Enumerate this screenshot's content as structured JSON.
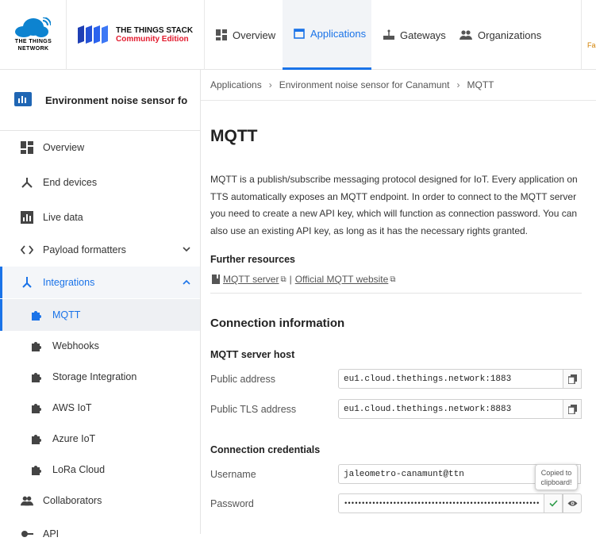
{
  "header": {
    "ttn_logo_text": "THE THINGS NETWORK",
    "tts_title": "THE THINGS STACK",
    "tts_subtitle": "Community Edition",
    "nav": [
      {
        "label": "Overview",
        "icon": "grid-icon"
      },
      {
        "label": "Applications",
        "icon": "application-icon",
        "active": true
      },
      {
        "label": "Gateways",
        "icon": "gateway-icon"
      },
      {
        "label": "Organizations",
        "icon": "people-icon"
      }
    ],
    "truncated_right": "Fa"
  },
  "sidebar": {
    "app_name": "Environment noise sensor for ...",
    "items": [
      {
        "label": "Overview",
        "icon": "dashboard-icon"
      },
      {
        "label": "End devices",
        "icon": "devices-icon"
      },
      {
        "label": "Live data",
        "icon": "chart-icon"
      },
      {
        "label": "Payload formatters",
        "icon": "code-icon",
        "expandable": true
      },
      {
        "label": "Integrations",
        "icon": "integrations-icon",
        "expanded": true
      },
      {
        "label": "MQTT",
        "icon": "puzzle-icon",
        "active": true
      },
      {
        "label": "Webhooks",
        "icon": "puzzle-icon"
      },
      {
        "label": "Storage Integration",
        "icon": "puzzle-icon"
      },
      {
        "label": "AWS IoT",
        "icon": "puzzle-icon"
      },
      {
        "label": "Azure IoT",
        "icon": "puzzle-icon"
      },
      {
        "label": "LoRa Cloud",
        "icon": "puzzle-icon"
      },
      {
        "label": "Collaborators",
        "icon": "people-icon"
      },
      {
        "label": "API",
        "icon": "key-icon"
      }
    ]
  },
  "breadcrumb": [
    "Applications",
    "Environment noise sensor for Canamunt",
    "MQTT"
  ],
  "main": {
    "title": "MQTT",
    "intro": "MQTT is a publish/subscribe messaging protocol designed for IoT. Every application on TTS automatically exposes an MQTT endpoint. In order to connect to the MQTT server you need to create a new API key, which will function as connection password. You can also use an existing API key, as long as it has the necessary rights granted.",
    "further_resources": "Further resources",
    "link1": "MQTT server",
    "link_sep": "|",
    "link2": "Official MQTT website",
    "connection_info": "Connection information",
    "server_host": "MQTT server host",
    "public_address_label": "Public address",
    "public_address": "eu1.cloud.thethings.network:1883",
    "public_tls_label": "Public TLS address",
    "public_tls_address": "eu1.cloud.thethings.network:8883",
    "credentials": "Connection credentials",
    "username_label": "Username",
    "username": "jaleometro-canamunt@ttn",
    "password_label": "Password",
    "password_masked": "••••••••••••••••••••••••••••••••••••••••••••••••••••••••",
    "tooltip": "Copied to clipboard!"
  },
  "colors": {
    "accent": "#1a73e8",
    "brand_red": "#e21b2e",
    "success": "#2e9c4a"
  }
}
